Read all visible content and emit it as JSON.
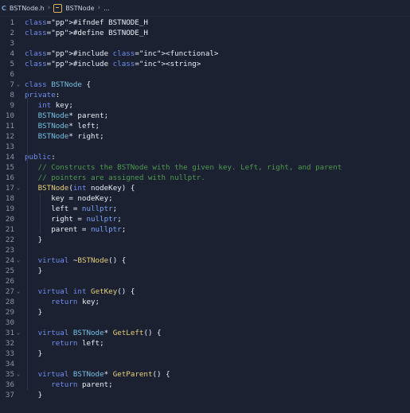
{
  "breadcrumb": {
    "file_icon": "C",
    "file": "BSTNode.h",
    "symbol": "BSTNode",
    "ellipsis": "..."
  },
  "line_numbers": [
    "1",
    "2",
    "3",
    "4",
    "5",
    "6",
    "7",
    "8",
    "9",
    "10",
    "11",
    "12",
    "13",
    "14",
    "15",
    "16",
    "17",
    "18",
    "19",
    "20",
    "21",
    "22",
    "23",
    "24",
    "25",
    "26",
    "27",
    "28",
    "29",
    "30",
    "31",
    "32",
    "33",
    "34",
    "35",
    "36",
    "37"
  ],
  "code": [
    {
      "t": "#ifndef BSTNODE_H"
    },
    {
      "t": "#define BSTNODE_H"
    },
    {
      "t": ""
    },
    {
      "t": "#include <functional>"
    },
    {
      "t": "#include <string>"
    },
    {
      "t": ""
    },
    {
      "t": "class BSTNode {",
      "fold": "v"
    },
    {
      "t": "private:"
    },
    {
      "t": "   int key;"
    },
    {
      "t": "   BSTNode* parent;"
    },
    {
      "t": "   BSTNode* left;"
    },
    {
      "t": "   BSTNode* right;"
    },
    {
      "t": ""
    },
    {
      "t": "public:"
    },
    {
      "t": "   // Constructs the BSTNode with the given key. Left, right, and parent"
    },
    {
      "t": "   // pointers are assigned with nullptr."
    },
    {
      "t": "   BSTNode(int nodeKey) {",
      "fold": "v"
    },
    {
      "t": "      key = nodeKey;"
    },
    {
      "t": "      left = nullptr;"
    },
    {
      "t": "      right = nullptr;"
    },
    {
      "t": "      parent = nullptr;"
    },
    {
      "t": "   }"
    },
    {
      "t": ""
    },
    {
      "t": "   virtual ~BSTNode() {",
      "fold": "v"
    },
    {
      "t": "   }"
    },
    {
      "t": ""
    },
    {
      "t": "   virtual int GetKey() {",
      "fold": "v"
    },
    {
      "t": "      return key;"
    },
    {
      "t": "   }"
    },
    {
      "t": ""
    },
    {
      "t": "   virtual BSTNode* GetLeft() {",
      "fold": "v"
    },
    {
      "t": "      return left;"
    },
    {
      "t": "   }"
    },
    {
      "t": ""
    },
    {
      "t": "   virtual BSTNode* GetParent() {",
      "fold": "v"
    },
    {
      "t": "      return parent;"
    },
    {
      "t": "   }"
    }
  ]
}
